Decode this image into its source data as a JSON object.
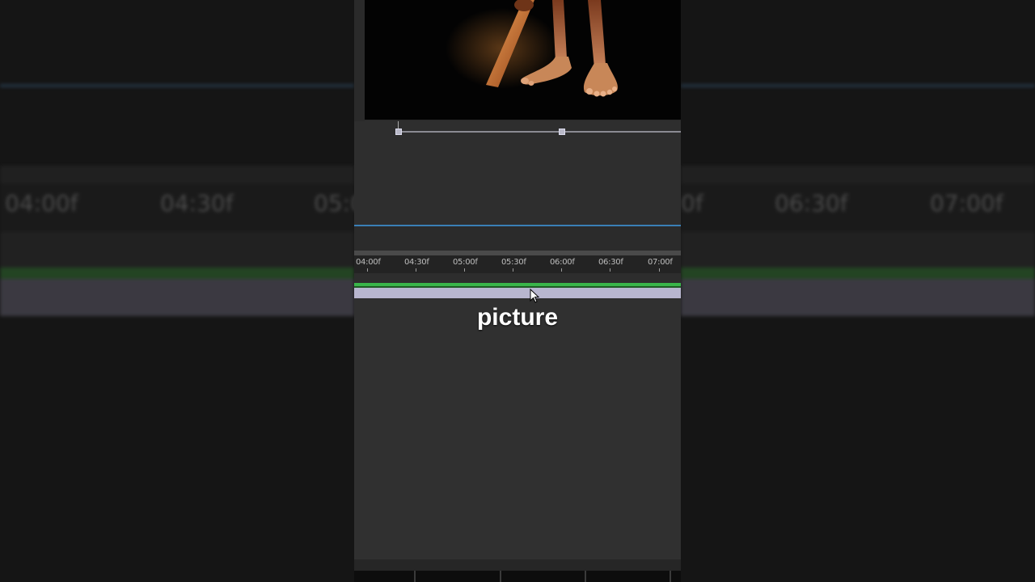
{
  "background": {
    "left_timecodes": [
      "04:00f",
      "04:30f",
      "05:0"
    ],
    "right_timecodes": [
      "0f",
      "06:30f",
      "07:00f"
    ]
  },
  "viewer": {
    "subject": "figure with bare feet holding a glowing bat"
  },
  "timeline": {
    "timecodes": [
      "04:00f",
      "04:30f",
      "05:00f",
      "05:30f",
      "06:00f",
      "06:30f",
      "07:00f"
    ]
  },
  "caption": "picture",
  "colors": {
    "green_track": "#39b54a",
    "lavender_track": "#b8b6cf",
    "blue_line": "#3a7fb6"
  }
}
